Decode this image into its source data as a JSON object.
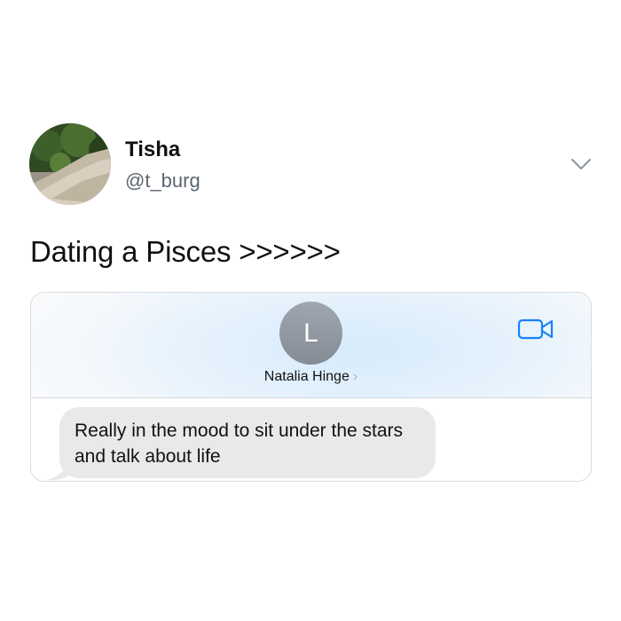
{
  "tweet": {
    "author_name": "Tisha",
    "author_handle": "@t_burg",
    "text": "Dating a Pisces >>>>>>",
    "menu_icon": "chevron-down-icon"
  },
  "message_card": {
    "contact_initial": "L",
    "contact_name": "Natalia Hinge",
    "contact_chevron": "›",
    "video_icon": "video-camera-icon",
    "colors": {
      "bubble": "#e9e9eb",
      "accent": "#1a82fb"
    },
    "messages": [
      {
        "direction": "incoming",
        "text": "Really in the mood to sit under the stars and talk about life"
      }
    ]
  }
}
